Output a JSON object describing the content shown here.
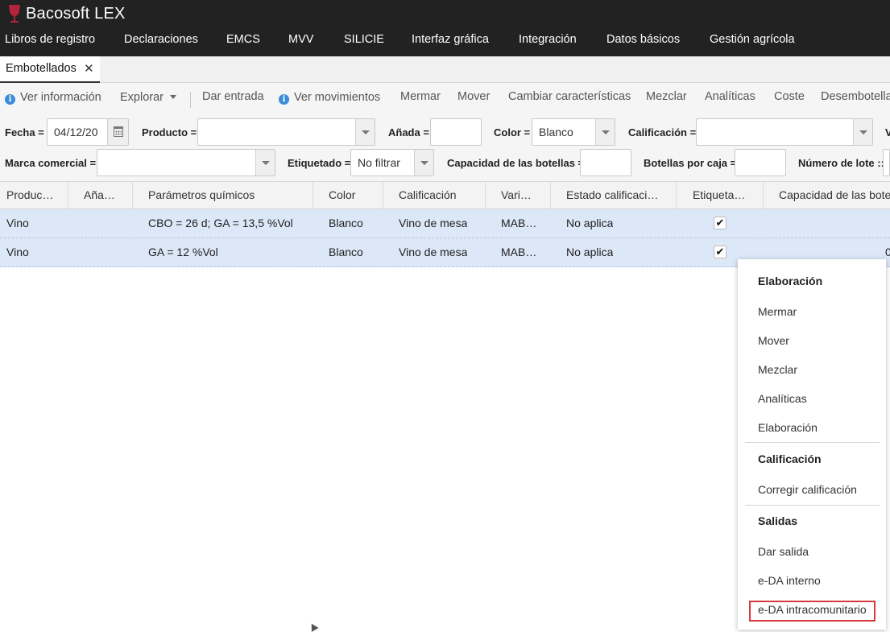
{
  "app": {
    "title": "Bacosoft LEX",
    "logo_icon": "wine-glass-icon",
    "logo_color": "#b3233a"
  },
  "menu": [
    "Libros de registro",
    "Declaraciones",
    "EMCS",
    "MVV",
    "SILICIE",
    "Interfaz gráfica",
    "Integración",
    "Datos básicos",
    "Gestión agrícola"
  ],
  "tabs": [
    {
      "label": "Embotellados",
      "close_icon": "close-icon"
    }
  ],
  "toolbar": {
    "ver_informacion": "Ver información",
    "explorar": "Explorar",
    "dar_entrada": "Dar entrada",
    "ver_movimientos": "Ver movimientos",
    "mermar": "Mermar",
    "mover": "Mover",
    "cambiar": "Cambiar características",
    "mezclar": "Mezclar",
    "analiticas": "Analíticas",
    "coste": "Coste",
    "desembotellar": "Desembotella"
  },
  "filters": {
    "fecha_label": "Fecha =",
    "fecha_value": "04/12/20",
    "producto_label": "Producto =",
    "producto_value": "",
    "anada_label": "Añada =",
    "anada_value": "",
    "color_label": "Color =",
    "color_value": "Blanco",
    "calificacion_label": "Calificación =",
    "calificacion_value": "",
    "cut_label": "V",
    "marca_label": "Marca comercial =",
    "marca_value": "",
    "etiquetado_label": "Etiquetado =",
    "etiquetado_value": "No filtrar",
    "capacidad_label": "Capacidad de las botellas =",
    "capacidad_value": "",
    "botellas_label": "Botellas por caja =",
    "botellas_value": "",
    "lote_label": "Número de lote ::"
  },
  "grid": {
    "columns": [
      "Produc…",
      "Aña…",
      "Parámetros químicos",
      "Color",
      "Calificación",
      "Vari…",
      "Estado calificaci…",
      "Etiqueta…",
      "Capacidad de las bote"
    ],
    "rows": [
      {
        "producto": "Vino",
        "anada": "",
        "parametros": "CBO = 26 d; GA = 13,5 %Vol",
        "color": "Blanco",
        "calificacion": "Vino de mesa",
        "variedad": "MAB…",
        "estado": "No aplica",
        "etiquetado": true,
        "capacidad": ""
      },
      {
        "producto": "Vino",
        "anada": "",
        "parametros": "GA = 12 %Vol",
        "color": "Blanco",
        "calificacion": "Vino de mesa",
        "variedad": "MAB…",
        "estado": "No aplica",
        "etiquetado": true,
        "capacidad": "0"
      }
    ],
    "checkmark": "✔",
    "row_color": "#dce7f7"
  },
  "context_menu": {
    "sections": [
      {
        "title": "Elaboración",
        "items": [
          "Mermar",
          "Mover",
          "Mezclar",
          "Analíticas",
          "Elaboración"
        ]
      },
      {
        "title": "Calificación",
        "items": [
          "Corregir calificación"
        ]
      },
      {
        "title": "Salidas",
        "items": [
          "Dar salida",
          "e-DA interno",
          "e-DA intracomunitario"
        ]
      }
    ],
    "highlighted_item": "e-DA intracomunitario",
    "highlight_color": "#d9363e"
  }
}
